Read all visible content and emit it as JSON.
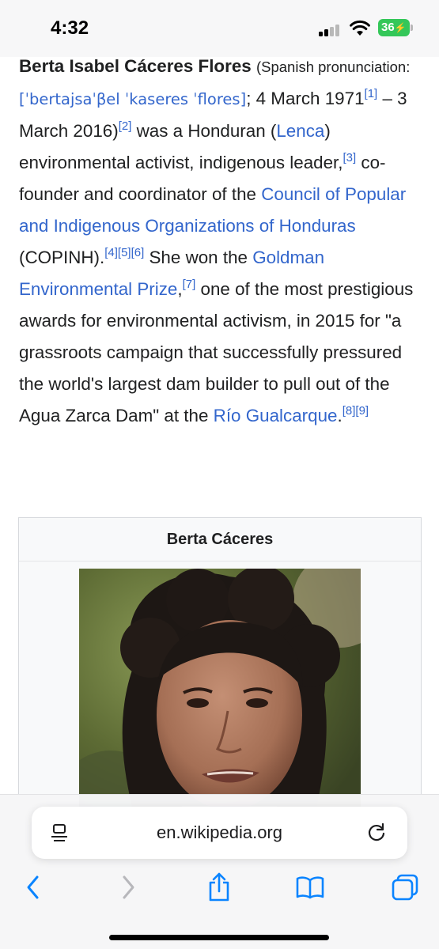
{
  "status_bar": {
    "time": "4:32",
    "battery_level": "36"
  },
  "article": {
    "name": "Berta Isabel Cáceres Flores",
    "lang_note": "(Spanish pronunciation:",
    "ipa": "[ˈbertajsaˈβel ˈkaseres ˈflores]",
    "after_ipa": "; 4 March 1971",
    "ref1": "[1]",
    "dash_death": " – 3 March 2016)",
    "ref2": "[2]",
    "t_was": " was a Honduran (",
    "link_lenca": "Lenca",
    "t_activist": ") environmental activist, indigenous leader,",
    "ref3": "[3]",
    "t_cofounder": " co-founder and coordinator of the ",
    "link_council": "Council of Popular and Indigenous Organizations of Honduras",
    "t_copinh": " (COPINH).",
    "ref4": "[4]",
    "ref5": "[5]",
    "ref6": "[6]",
    "t_won": " She won the ",
    "link_goldman": "Goldman Environmental Prize",
    "t_comma": ",",
    "ref7": "[7]",
    "t_awards": " one of the most prestigious awards for environmental activism, in 2015 for \"a grassroots campaign that successfully pressured the world's largest dam builder to pull out of the Agua Zarca Dam\" at the ",
    "link_rio": "Río Gualcarque",
    "t_period": ".",
    "ref8": "[8]",
    "ref9": "[9]"
  },
  "infobox": {
    "title": "Berta Cáceres"
  },
  "address_bar": {
    "url": "en.wikipedia.org"
  },
  "toolbar": {
    "items": [
      "back-icon",
      "forward-icon",
      "share-icon",
      "bookmarks-icon",
      "tabs-icon"
    ]
  },
  "colors": {
    "link": "#3366cc",
    "ios_accent": "#0a84ff",
    "battery": "#34c759"
  }
}
